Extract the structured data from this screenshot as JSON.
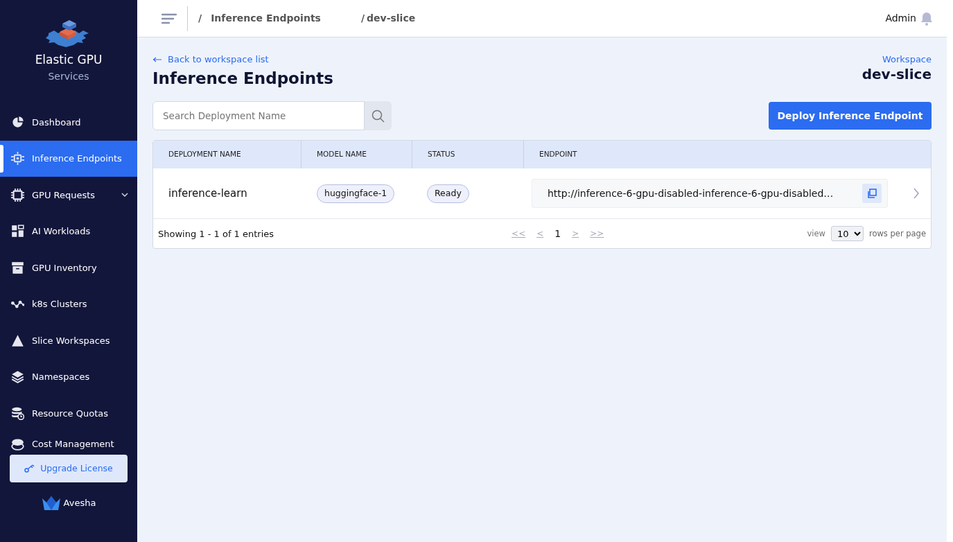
{
  "sidebar": {
    "brand": {
      "title": "Elastic GPU",
      "subtitle": "Services"
    },
    "items": [
      {
        "label": "Dashboard",
        "selected": false,
        "expandable": false
      },
      {
        "label": "Inference Endpoints",
        "selected": true,
        "expandable": false
      },
      {
        "label": "GPU Requests",
        "selected": false,
        "expandable": true
      },
      {
        "label": "AI Workloads",
        "selected": false,
        "expandable": false
      },
      {
        "label": "GPU Inventory",
        "selected": false,
        "expandable": false
      },
      {
        "label": "k8s Clusters",
        "selected": false,
        "expandable": false
      },
      {
        "label": "Slice Workspaces",
        "selected": false,
        "expandable": false
      },
      {
        "label": "Namespaces",
        "selected": false,
        "expandable": false
      },
      {
        "label": "Resource Quotas",
        "selected": false,
        "expandable": false
      },
      {
        "label": "Cost Management",
        "selected": false,
        "expandable": false
      }
    ],
    "upgrade_button": "Upgrade License",
    "footer_logo": "Avesha"
  },
  "topbar": {
    "breadcrumbs": [
      {
        "separator": "/",
        "label": "Inference Endpoints"
      },
      {
        "separator": "/",
        "label": "dev-slice"
      }
    ],
    "user": "Admin"
  },
  "page": {
    "back_link": "Back to workspace list",
    "title": "Inference Endpoints",
    "workspace_label": "Workspace",
    "workspace_name": "dev-slice"
  },
  "search": {
    "placeholder": "Search Deployment Name"
  },
  "deploy_button": "Deploy Inference Endpoint",
  "table": {
    "columns": [
      "DEPLOYMENT NAME",
      "MODEL NAME",
      "STATUS",
      "ENDPOINT"
    ],
    "rows": [
      {
        "deployment": "inference-learn",
        "model": "huggingface-1",
        "status": "Ready",
        "endpoint": "http://inference-6-gpu-disabled-inference-6-gpu-disabled…"
      }
    ]
  },
  "pagination": {
    "summary": "Showing 1 - 1 of 1 entries",
    "first": "<<",
    "prev": "<",
    "page": "1",
    "next": ">",
    "last": ">>",
    "view_label": "view",
    "rows_per_page": "10",
    "rows_label": "rows per page"
  }
}
